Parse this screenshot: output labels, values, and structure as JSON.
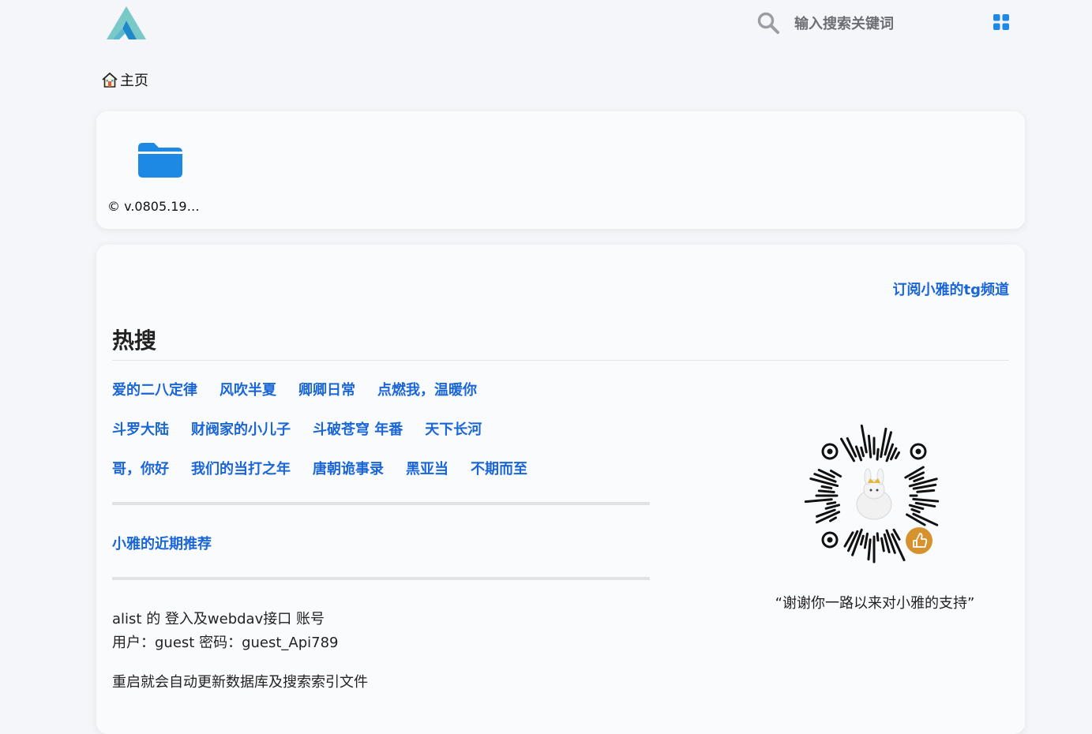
{
  "header": {
    "search": {
      "placeholder": "输入搜索关键词",
      "icon": "search-icon"
    },
    "layout_toggle_icon": "grid-icon",
    "accent_color": "#1e88e5"
  },
  "breadcrumb": {
    "home_label": "主页"
  },
  "files": [
    {
      "name": "© v.0805.19…",
      "icon": "folder-icon"
    }
  ],
  "readme": {
    "tg_link": "订阅小雅的tg频道",
    "hot_title": "热搜",
    "hot_rows": [
      [
        "爱的二八定律",
        "风吹半夏",
        "卿卿日常",
        "点燃我，温暖你"
      ],
      [
        "斗罗大陆",
        "财阀家的小儿子",
        "斗破苍穹 年番",
        "天下长河"
      ],
      [
        "哥，你好",
        "我们的当打之年",
        "唐朝诡事录",
        "黑亚当",
        "不期而至"
      ]
    ],
    "recommend_link": "小雅的近期推荐",
    "login_info_line1": "alist 的 登入及webdav接口 账号",
    "login_info_line2": "用户：guest 密码：guest_Api789",
    "restart_note": "重启就会自动更新数据库及搜索索引文件",
    "qr_caption": "“谢谢你一路以来对小雅的支持”",
    "link_color": "#1a66d6"
  }
}
